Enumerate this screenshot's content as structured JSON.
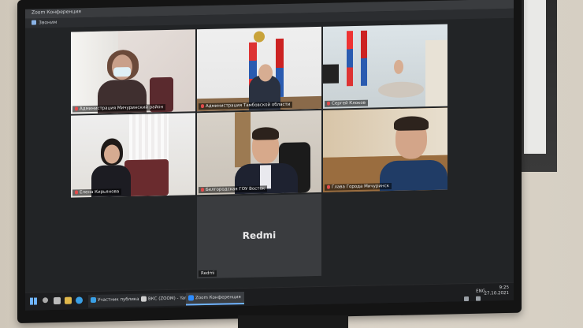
{
  "window": {
    "title_text": "Zoom Конференция",
    "subbar_text": "Звоним"
  },
  "tiles": [
    {
      "label": "Администрация Мичуринский район"
    },
    {
      "label": "Администрация Тамбовской области"
    },
    {
      "label": "Сергей Клоков"
    },
    {
      "label": "Елена Кирьянова"
    },
    {
      "label": "Белгородская ГОУ Восток"
    },
    {
      "label": "Глава Города Мичуринск"
    }
  ],
  "speaker_tile": {
    "name": "Redmi",
    "label": "Redmi"
  },
  "taskbar": {
    "apps": [
      {
        "label": "Участник публикац...",
        "color": "#3aa0e6"
      },
      {
        "label": "ВКС (ZOOM) - Yand...",
        "color": "#cfcfcf"
      },
      {
        "label": "Zoom Конференция",
        "color": "#2d8cff"
      }
    ],
    "lang": "ENG",
    "time": "9:25",
    "date": "27.10.2021"
  }
}
